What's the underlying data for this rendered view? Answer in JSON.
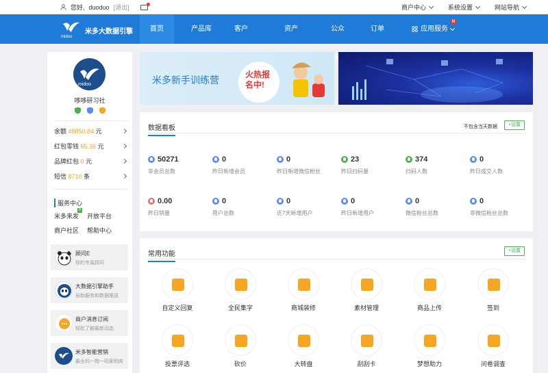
{
  "topbar": {
    "greeting": "您好,",
    "username": "duoduo",
    "logout": "[退出]",
    "links": [
      "商户中心",
      "系统设置",
      "网站导航"
    ]
  },
  "nav": {
    "brand": "米多大数据引擎",
    "logo_text": "midoo",
    "items": [
      {
        "label": "首页",
        "active": true
      },
      {
        "label": "产品库"
      },
      {
        "label": "客户"
      },
      {
        "label": "资产"
      },
      {
        "label": "公众号"
      },
      {
        "label": "订单"
      },
      {
        "label": "应用服务",
        "badge": "N"
      }
    ]
  },
  "sidebar": {
    "avatar_text": "midoo",
    "org_name": "哆哆研习社",
    "rows": [
      {
        "label": "余额",
        "amount": "48850.84",
        "unit": "元"
      },
      {
        "label": "红包零钱",
        "amount": "65.36",
        "unit": "元"
      },
      {
        "label": "品牌红包",
        "amount": "0",
        "unit": "元"
      },
      {
        "label": "短信",
        "amount": "8710",
        "unit": "条"
      }
    ],
    "service_title": "服务中心",
    "services": [
      "米多来发",
      "开放平台",
      "商户社区",
      "帮助中心"
    ],
    "service_badge": "H",
    "cards": [
      {
        "title": "顾问E",
        "sub": "你的专属顾问"
      },
      {
        "title": "大数据引擎助手",
        "sub": "自助服务和数据推送"
      },
      {
        "title": "商户消息订阅",
        "sub": "轻松了解最新动态"
      },
      {
        "title": "米多智能营销",
        "sub": "最全的一物一码案例库"
      }
    ]
  },
  "banner1": {
    "title": "米多新手训练营",
    "bubble": "火热报名中!"
  },
  "dashboard": {
    "title": "数据看板",
    "note": "不包含当天数据",
    "settings": "+设置",
    "stats": [
      {
        "value": "50271",
        "label": "非会员总数",
        "color": "#5b8def"
      },
      {
        "value": "0",
        "label": "昨日新增会员",
        "color": "#5b8def"
      },
      {
        "value": "0",
        "label": "昨日新增微信粉丝",
        "color": "#5b8def"
      },
      {
        "value": "23",
        "label": "昨日扫码量",
        "color": "#4caf50"
      },
      {
        "value": "374",
        "label": "扫码人数",
        "color": "#4caf50"
      },
      {
        "value": "0",
        "label": "昨日成交人数",
        "color": "#5b8def"
      },
      {
        "value": "0.00",
        "label": "昨日销量",
        "color": "#e57373"
      },
      {
        "value": "0",
        "label": "用户总数",
        "color": "#5b8def"
      },
      {
        "value": "0",
        "label": "近7天新增用户",
        "color": "#5b8def"
      },
      {
        "value": "0",
        "label": "昨日新增用户",
        "color": "#5b8def"
      },
      {
        "value": "0",
        "label": "微信粉丝总数",
        "color": "#5b8def"
      },
      {
        "value": "0",
        "label": "非微信粉丝总数",
        "color": "#5b8def"
      }
    ]
  },
  "functions": {
    "title": "常用功能",
    "settings": "+设置",
    "items": [
      {
        "label": "自定义回复",
        "icon": "chat-icon"
      },
      {
        "label": "全民集字",
        "icon": "gear-icon"
      },
      {
        "label": "商城装修",
        "icon": "store-icon"
      },
      {
        "label": "素材管理",
        "icon": "material-icon"
      },
      {
        "label": "商品上传",
        "icon": "upload-icon"
      },
      {
        "label": "签到",
        "icon": "calendar-icon"
      },
      {
        "label": "投票评选",
        "icon": "vote-icon"
      },
      {
        "label": "砍价",
        "icon": "yen-icon"
      },
      {
        "label": "大转盘",
        "icon": "wheel-icon"
      },
      {
        "label": "刮刮卡",
        "icon": "card-icon"
      },
      {
        "label": "梦想助力",
        "icon": "boost-icon"
      },
      {
        "label": "问卷调查",
        "icon": "survey-icon"
      }
    ]
  }
}
